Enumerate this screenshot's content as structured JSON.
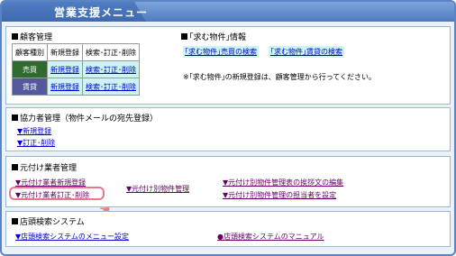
{
  "window": {
    "title": "営業支援メニュー"
  },
  "customer": {
    "heading": "顧客管理",
    "headers": [
      "顧客種別",
      "新規登録",
      "検索･訂正･削除"
    ],
    "rows": [
      {
        "type": "売買",
        "new": "新規登録",
        "edit": "検索･訂正･削除"
      },
      {
        "type": "賃貸",
        "new": "新規登録",
        "edit": "検索･訂正･削除"
      }
    ]
  },
  "wanted": {
    "heading": "｢求む物件｣情報",
    "btn_sale": "｢求む物件｣売買の検索",
    "btn_rent": "｢求む物件｣賃貸の検索",
    "note": "※｢求む物件｣の新規登録は、顧客管理から行ってください。"
  },
  "partner": {
    "heading": "協力者管理（物件メールの宛先登録）",
    "link_new": "▼新規登録",
    "link_edit": "▼訂正･削除"
  },
  "agent": {
    "heading": "元付け業者管理",
    "link_new": "▼元付け業者新規登録",
    "link_edit": "▼元付け業者訂正･削除",
    "link_property": "▼元付け別物件管理",
    "link_greeting": "▼元付け別物件管理表の挨拶文の編集",
    "link_person": "▼元付け別物件管理の担当者を設定"
  },
  "store": {
    "heading": "店頭検索システム",
    "link_menu": "▼店頭検索システムのメニュー設定",
    "link_manual": "●店頭検索システムのマニュアル"
  },
  "colors": {
    "accent": "#4f7cc2",
    "sell": "#2f6b2f",
    "rent": "#55589a",
    "highlight": "#e8788c"
  }
}
